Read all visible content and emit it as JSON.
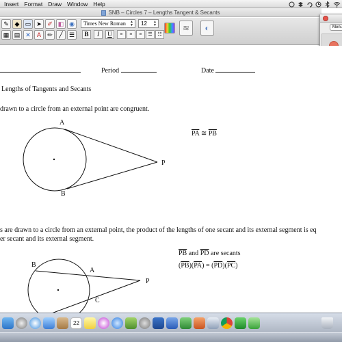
{
  "menubar": {
    "items": [
      "Insert",
      "Format",
      "Draw",
      "Window",
      "Help"
    ],
    "status_icons": [
      "notification-icon",
      "dropbox-icon",
      "sync-icon",
      "time-machine-icon",
      "bluetooth-icon",
      "wifi-icon"
    ]
  },
  "window": {
    "title": "SNB – Circles 7 – Lengths Tangent & Secants"
  },
  "toolbar": {
    "font_family": "Times New Roman",
    "font_size": "12",
    "bold_label": "B",
    "italic_label": "I",
    "underline_label": "U"
  },
  "panel": {
    "button_label": "Menu"
  },
  "document": {
    "period_label": "Period",
    "date_label": "Date",
    "heading": "Lengths of Tangents and Secants",
    "theorem1": "drawn to a circle from an external point are congruent.",
    "tangent_figure": {
      "point_a": "A",
      "point_b": "B",
      "point_p": "P"
    },
    "tangent_statement": {
      "left": "PA",
      "symbol": "≅",
      "right": "PB"
    },
    "theorem2_line1": "s are drawn to a circle from an external point, the product of the lengths of one secant and its external segment is eq",
    "theorem2_line2": "er secant and its external segment.",
    "secant_figure": {
      "point_b": "B",
      "point_a": "A",
      "point_p": "P",
      "point_c": "C"
    },
    "secants_statement": {
      "seg1": "PB",
      "and": "and",
      "seg2": "PD",
      "suffix": "are secants"
    },
    "secant_equation": {
      "s1": "PB",
      "s2": "PA",
      "eq": "=",
      "s3": "PD",
      "s4": "PC"
    }
  },
  "dock": {
    "calendar_day": "22",
    "apps": [
      "finder-icon",
      "launchpad-icon",
      "safari-icon",
      "mail-icon",
      "contacts-icon",
      "calendar-icon",
      "notes-icon",
      "itunes-icon",
      "app-store-icon",
      "photos-icon",
      "system-preferences-icon",
      "smart-notebook-icon",
      "word-icon",
      "excel-icon",
      "powerpoint-icon",
      "preview-icon",
      "chrome-icon",
      "camtasia-icon",
      "facetime-icon",
      "trash-icon"
    ]
  }
}
